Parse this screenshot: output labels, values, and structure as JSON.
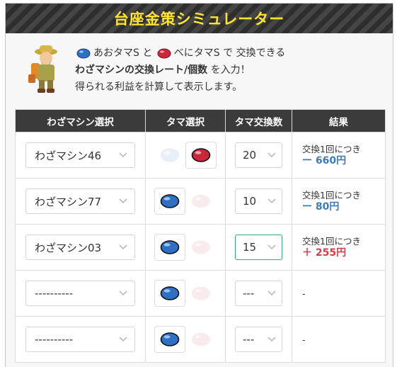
{
  "title": "台座金策シミュレーター",
  "intro": {
    "gem_blue": "あおタマS",
    "and": "と",
    "gem_red": "べにタマS",
    "line1_suffix": "で 交換できる",
    "line2_bold": "わざマシンの交換レート/個数",
    "line2_suffix": "を入力！",
    "line3": "得られる利益を計算して表示します。"
  },
  "table": {
    "headers": [
      "わざマシン選択",
      "タマ選択",
      "タマ交換数",
      "結果"
    ],
    "rows": [
      {
        "tm": "わざマシン46",
        "selected_gem": "red",
        "count": "20",
        "result_label": "交換1回につき",
        "result_value": "ー 660円",
        "result_sign": "neg"
      },
      {
        "tm": "わざマシン77",
        "selected_gem": "blue",
        "count": "10",
        "result_label": "交換1回につき",
        "result_value": "ー 80円",
        "result_sign": "neg"
      },
      {
        "tm": "わざマシン03",
        "selected_gem": "blue",
        "count": "15",
        "result_label": "交換1回につき",
        "result_value": "＋ 255円",
        "result_sign": "pos",
        "focused": true
      },
      {
        "tm": "----------",
        "selected_gem": "blue",
        "count": "---",
        "result_label": "-",
        "result_value": "",
        "result_sign": "none"
      },
      {
        "tm": "----------",
        "selected_gem": "blue",
        "count": "---",
        "result_label": "-",
        "result_value": "",
        "result_sign": "none"
      }
    ]
  },
  "colors": {
    "title_text": "#ffe431",
    "blue_gem": "#2f6fc4",
    "red_gem": "#c8283a",
    "negative": "#3d7ab8",
    "positive": "#d83a4a"
  }
}
